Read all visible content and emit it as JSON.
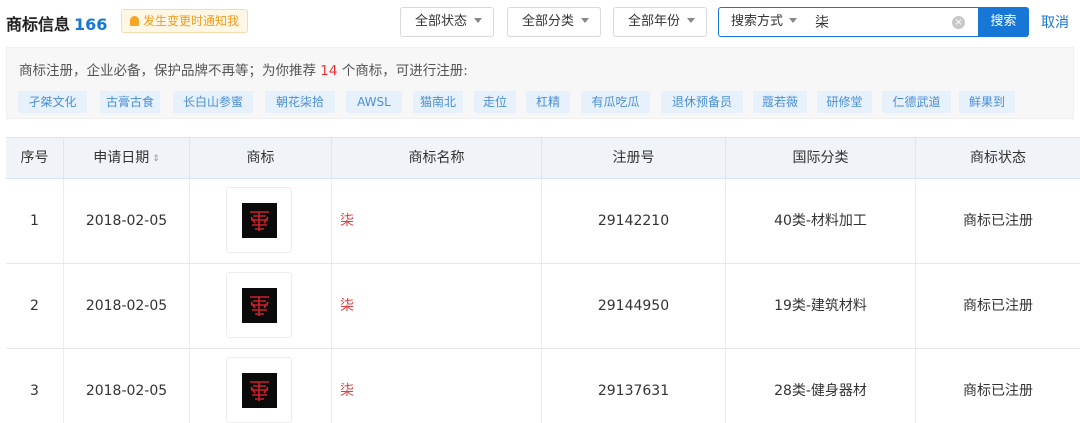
{
  "header": {
    "title": "商标信息",
    "count": "166",
    "notify_label": "发生变更时通知我"
  },
  "filters": {
    "status": "全部状态",
    "category": "全部分类",
    "year": "全部年份"
  },
  "search": {
    "mode_label": "搜索方式",
    "value": "柒",
    "clear_icon": "×",
    "button_label": "搜索",
    "cancel_label": "取消"
  },
  "recommend": {
    "text_before": "商标注册，企业必备，保护品牌不再等；为你推荐 ",
    "count": "14",
    "text_after": " 个商标，可进行注册:",
    "tags": [
      "孑桀文化",
      "古膏古食",
      "长白山参蜜",
      "朝花柒拾",
      "AWSL",
      "猫南北",
      "走位",
      "杠精",
      "有瓜吃瓜",
      "退休预备员",
      "蔻若薇",
      "研修堂",
      "仁德武道",
      "鲜果到"
    ]
  },
  "table": {
    "headers": [
      "序号",
      "申请日期",
      "商标",
      "商标名称",
      "注册号",
      "国际分类",
      "商标状态"
    ],
    "sort_icon": "⇕",
    "rows": [
      {
        "index": "1",
        "date": "2018-02-05",
        "name": "柒",
        "reg_no": "29142210",
        "class": "40类-材料加工",
        "status": "商标已注册"
      },
      {
        "index": "2",
        "date": "2018-02-05",
        "name": "柒",
        "reg_no": "29144950",
        "class": "19类-建筑材料",
        "status": "商标已注册"
      },
      {
        "index": "3",
        "date": "2018-02-05",
        "name": "柒",
        "reg_no": "29137631",
        "class": "28类-健身器材",
        "status": "商标已注册"
      }
    ]
  },
  "colors": {
    "accent": "#1677d6",
    "highlight": "#e04040",
    "notify": "#f29b1c"
  },
  "icons": {
    "notify": "bell-icon",
    "dropdown": "caret-down-icon",
    "clear": "clear-icon",
    "sort": "sort-icon"
  }
}
